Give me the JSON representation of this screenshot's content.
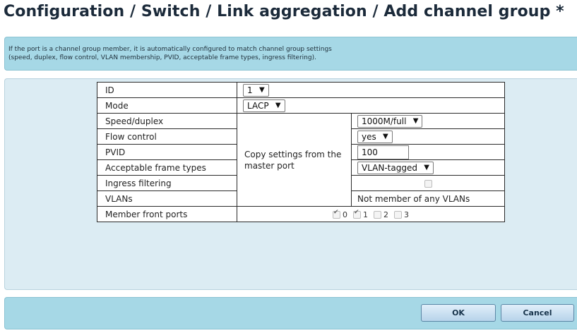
{
  "page": {
    "title": "Configuration / Switch / Link aggregation / Add channel group *"
  },
  "info": {
    "line1": "If the port is a channel group member, it is automatically configured to match channel group settings",
    "line2": "(speed, duplex, flow control, VLAN membership, PVID, acceptable frame types, ingress filtering)."
  },
  "form": {
    "id": {
      "label": "ID",
      "value": "1"
    },
    "mode": {
      "label": "Mode",
      "value": "LACP"
    },
    "copy_settings_label": "Copy settings from the master port",
    "speed_duplex": {
      "label": "Speed/duplex",
      "value": "1000M/full"
    },
    "flow_control": {
      "label": "Flow control",
      "value": "yes"
    },
    "pvid": {
      "label": "PVID",
      "value": "100"
    },
    "acceptable_frame_types": {
      "label": "Acceptable frame types",
      "value": "VLAN-tagged"
    },
    "ingress_filtering": {
      "label": "Ingress filtering",
      "checked": false,
      "disabled": true
    },
    "vlans": {
      "label": "VLANs",
      "value": "Not member of any VLANs"
    },
    "member_front_ports": {
      "label": "Member front ports",
      "ports": [
        {
          "number": "0",
          "checked": true
        },
        {
          "number": "1",
          "checked": true
        },
        {
          "number": "2",
          "checked": false
        },
        {
          "number": "3",
          "checked": false
        }
      ]
    }
  },
  "buttons": {
    "ok": "OK",
    "cancel": "Cancel"
  },
  "colors": {
    "panel_blue": "#a6d8e6",
    "form_background": "#dcecf3",
    "title_text": "#1b2a3a"
  }
}
